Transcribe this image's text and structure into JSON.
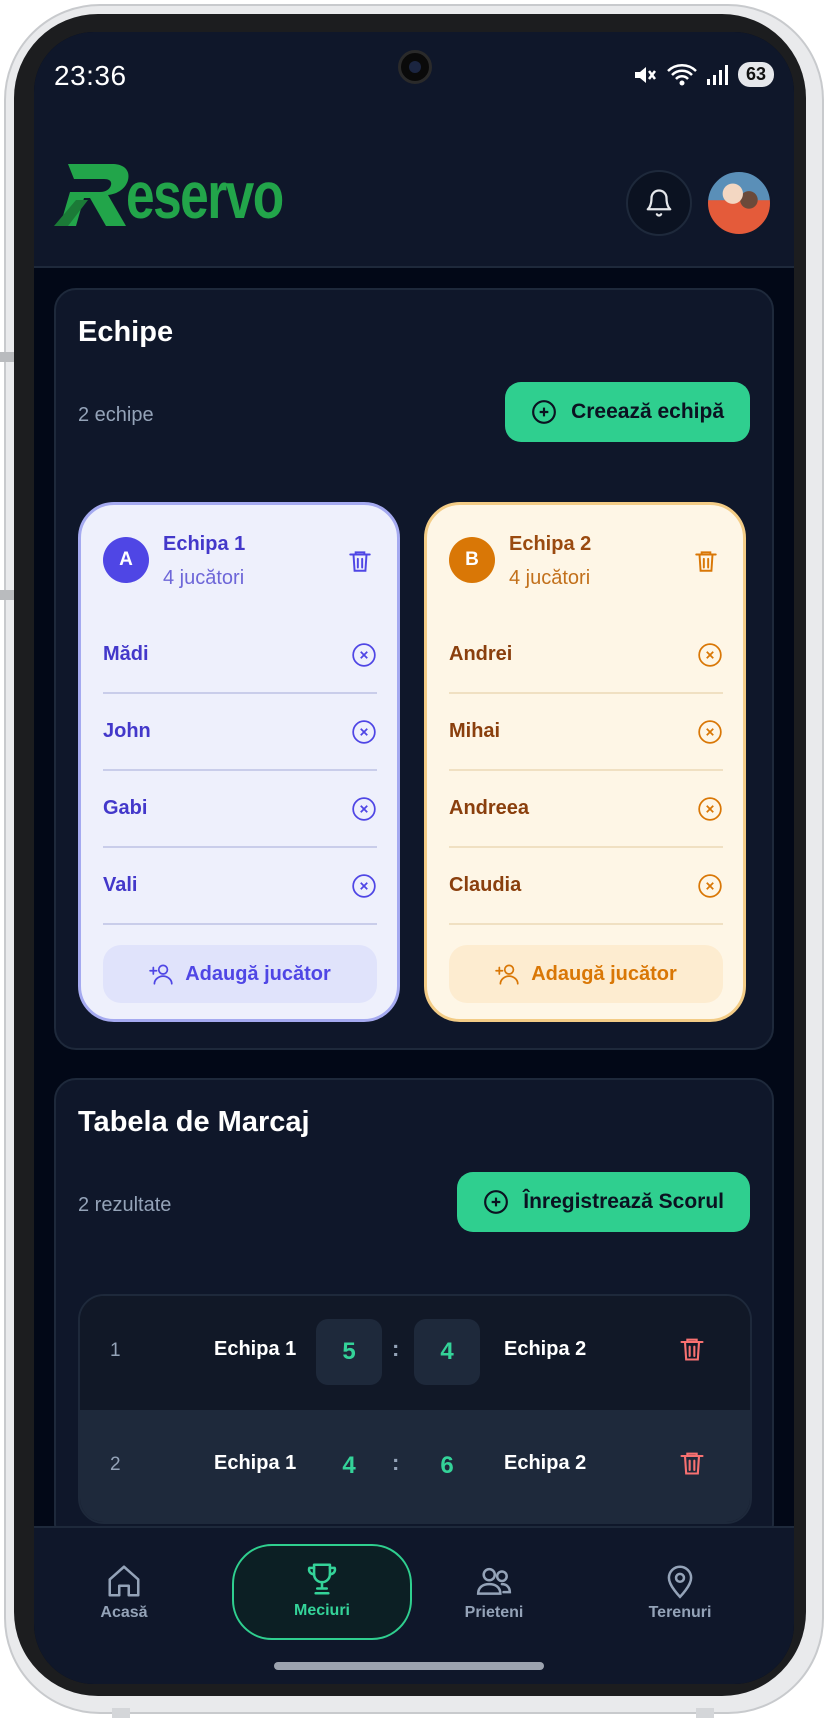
{
  "status": {
    "time": "23:36",
    "battery": "63"
  },
  "app": {
    "brand": "Reservo"
  },
  "teams_section": {
    "title": "Echipe",
    "count": "2 echipe",
    "create_label": "Creează echipă",
    "teams": [
      {
        "badge": "A",
        "name": "Echipa 1",
        "subtitle": "4 jucători",
        "players": [
          "Mădi",
          "John",
          "Gabi",
          "Vali"
        ],
        "add_label": "Adaugă jucător"
      },
      {
        "badge": "B",
        "name": "Echipa 2",
        "subtitle": "4 jucători",
        "players": [
          "Andrei",
          "Mihai",
          "Andreea",
          "Claudia"
        ],
        "add_label": "Adaugă jucător"
      }
    ]
  },
  "scoreboard": {
    "title": "Tabela de Marcaj",
    "count": "2 rezultate",
    "record_label": "Înregistrează Scorul",
    "rows": [
      {
        "rank": "1",
        "team1": "Echipa 1",
        "score1": "5",
        "sep": ":",
        "score2": "4",
        "team2": "Echipa 2"
      },
      {
        "rank": "2",
        "team1": "Echipa 1",
        "score1": "4",
        "sep": ":",
        "score2": "6",
        "team2": "Echipa 2"
      }
    ]
  },
  "nav": [
    {
      "label": "Acasă",
      "icon": "home-icon"
    },
    {
      "label": "Meciuri",
      "icon": "trophy-icon",
      "active": true
    },
    {
      "label": "Prieteni",
      "icon": "friends-icon"
    },
    {
      "label": "Terenuri",
      "icon": "map-pin-icon"
    }
  ],
  "colors": {
    "accent": "#2fcf8f",
    "team_a": "#4f46e5",
    "team_b": "#d97706",
    "danger": "#f87171",
    "background": "#020817"
  }
}
